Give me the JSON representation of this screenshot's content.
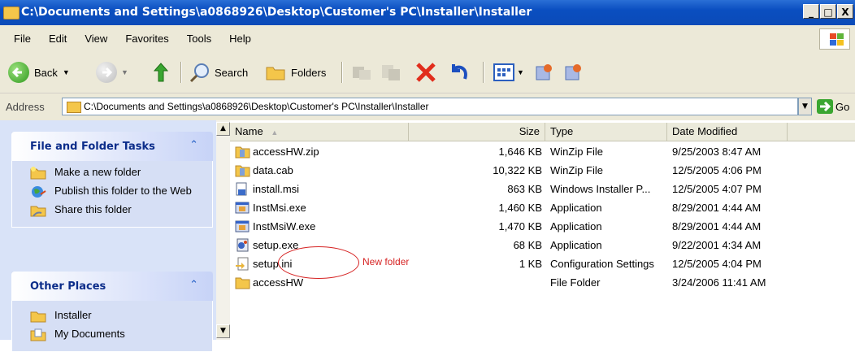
{
  "window": {
    "title": "C:\\Documents and Settings\\a0868926\\Desktop\\Customer's PC\\Installer\\Installer",
    "buttons": {
      "minimize": "_",
      "maximize": "□",
      "close": "X"
    }
  },
  "menu": [
    "File",
    "Edit",
    "View",
    "Favorites",
    "Tools",
    "Help"
  ],
  "toolbar": {
    "back_label": "Back",
    "search_label": "Search",
    "folders_label": "Folders"
  },
  "address": {
    "label": "Address",
    "value": "C:\\Documents and Settings\\a0868926\\Desktop\\Customer's PC\\Installer\\Installer",
    "go_label": "Go"
  },
  "tasks": {
    "file_folder": {
      "title": "File and Folder Tasks",
      "items": [
        "Make a new folder",
        "Publish this folder to the Web",
        "Share this folder"
      ]
    },
    "other_places": {
      "title": "Other Places",
      "items": [
        "Installer",
        "My Documents"
      ]
    }
  },
  "columns": {
    "name": "Name",
    "size": "Size",
    "type": "Type",
    "date": "Date Modified"
  },
  "files": [
    {
      "name": "accessHW.zip",
      "size": "1,646 KB",
      "type": "WinZip File",
      "date": "9/25/2003 8:47 AM",
      "icon": "zip-icon"
    },
    {
      "name": "data.cab",
      "size": "10,322 KB",
      "type": "WinZip File",
      "date": "12/5/2005 4:06 PM",
      "icon": "cab-icon"
    },
    {
      "name": "install.msi",
      "size": "863 KB",
      "type": "Windows Installer P...",
      "date": "12/5/2005 4:07 PM",
      "icon": "msi-icon"
    },
    {
      "name": "InstMsi.exe",
      "size": "1,460 KB",
      "type": "Application",
      "date": "8/29/2001 4:44 AM",
      "icon": "exe-icon"
    },
    {
      "name": "InstMsiW.exe",
      "size": "1,470 KB",
      "type": "Application",
      "date": "8/29/2001 4:44 AM",
      "icon": "exe-icon"
    },
    {
      "name": "setup.exe",
      "size": "68 KB",
      "type": "Application",
      "date": "9/22/2001 4:34 AM",
      "icon": "setup-exe-icon"
    },
    {
      "name": "setup.ini",
      "size": "1 KB",
      "type": "Configuration Settings",
      "date": "12/5/2005 4:04 PM",
      "icon": "ini-icon"
    },
    {
      "name": "accessHW",
      "size": "",
      "type": "File Folder",
      "date": "3/24/2006 11:41 AM",
      "icon": "folder-icon"
    }
  ],
  "annotation": {
    "text": "New folder",
    "color": "#d62323"
  },
  "colors": {
    "title_bar": "#0a4ec0",
    "task_pane": "#d6dff5",
    "chrome": "#ece9d8"
  }
}
